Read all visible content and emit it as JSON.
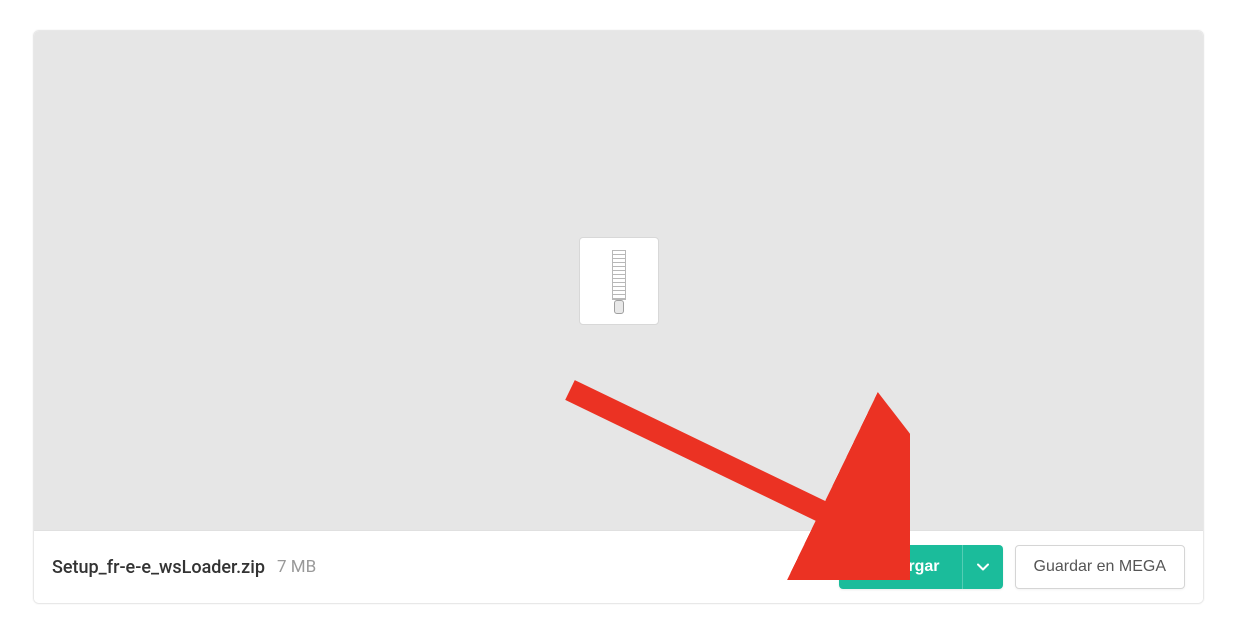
{
  "file": {
    "name": "Setup_fr-e-e_wsLoader.zip",
    "size": "7 MB",
    "icon": "zip-archive"
  },
  "actions": {
    "download_label": "Descargar",
    "save_label": "Guardar en MEGA"
  },
  "colors": {
    "accent": "#1bbc9b",
    "annotation": "#eb3223"
  }
}
